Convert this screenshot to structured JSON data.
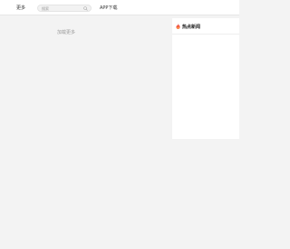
{
  "header": {
    "more_label": "更多",
    "search": {
      "placeholder": "搜索",
      "icon": "search-icon"
    },
    "app_download_label": "APP下载"
  },
  "main": {
    "load_more_label": "加载更多"
  },
  "sidebar": {
    "hot_news": {
      "title": "热点新闻",
      "icon": "fire-icon",
      "accent_color": "#f04a3a"
    }
  },
  "colors": {
    "page_bg": "#f3f3f3",
    "panel_bg": "#ffffff",
    "text": "#333333",
    "muted": "#999999"
  }
}
